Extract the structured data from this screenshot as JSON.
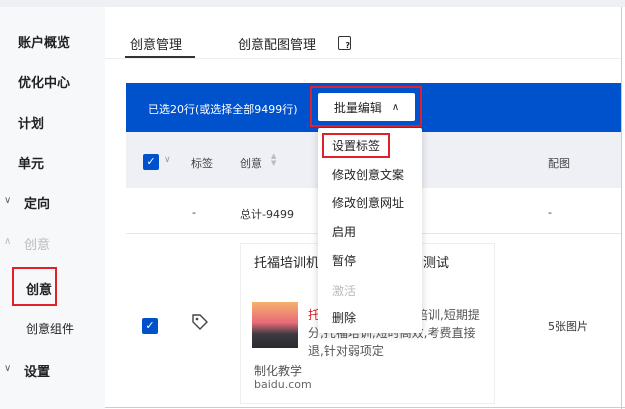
{
  "sidebar": {
    "items": [
      {
        "label": "账户概览"
      },
      {
        "label": "优化中心"
      },
      {
        "label": "计划"
      },
      {
        "label": "单元"
      },
      {
        "label": "定向"
      },
      {
        "label": "创意"
      },
      {
        "label": "创意"
      },
      {
        "label": "创意组件"
      },
      {
        "label": "设置"
      }
    ]
  },
  "tabs": [
    {
      "label": "创意管理",
      "active": true
    },
    {
      "label": "创意配图管理"
    }
  ],
  "selection": {
    "info": "已选20行(或选择全部9499行)",
    "batch_edit": "批量编辑"
  },
  "table": {
    "headers": {
      "tag": "标签",
      "creative": "创意",
      "image": "配图"
    },
    "total": {
      "tag": "-",
      "creative": "总计-9499",
      "image": "-"
    },
    "rows": [
      {
        "title": "托福培训机构一对一入学准确测试",
        "desc_highlight": "托",
        "desc": "福培训机构一对一培训,短期提分,托福培训,短时高效,考费直接退,针对弱项定",
        "desc_tail": "制化教学",
        "domain": "baidu.com",
        "image": "5张图片",
        "checked": true
      }
    ]
  },
  "dropdown": {
    "items": [
      {
        "label": "设置标签"
      },
      {
        "label": "修改创意文案"
      },
      {
        "label": "修改创意网址"
      },
      {
        "label": "启用"
      },
      {
        "label": "暂停"
      },
      {
        "label": "激活",
        "disabled": true
      },
      {
        "label": "删除"
      }
    ]
  },
  "colors": {
    "accent": "#0052cc",
    "highlight_box": "#e0202a"
  }
}
